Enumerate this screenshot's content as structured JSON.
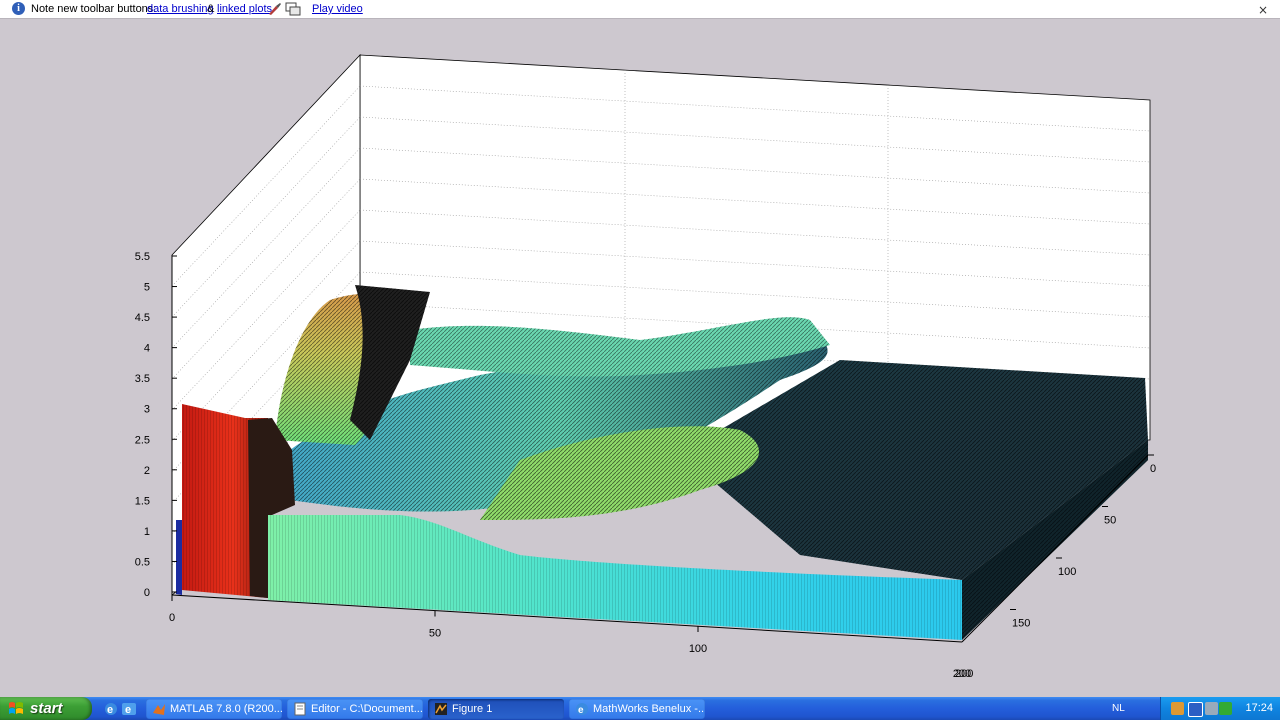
{
  "infobar": {
    "prefix": "Note new toolbar buttons:",
    "link_brushing": "data brushing",
    "amp": "&",
    "link_linked": "linked plots",
    "link_video": "Play video",
    "close": "×"
  },
  "plot": {
    "z_ticks": [
      "0",
      "0.5",
      "1",
      "1.5",
      "2",
      "2.5",
      "3",
      "3.5",
      "4",
      "4.5",
      "5",
      "5.5"
    ],
    "x_ticks": [
      "0",
      "50",
      "100"
    ],
    "x_end_tick": "200",
    "y_ticks": [
      "0",
      "50",
      "100",
      "150"
    ],
    "y_end_tick": "200"
  },
  "chart_data": {
    "type": "surface",
    "title": "",
    "xlabel": "",
    "ylabel": "",
    "zlabel": "",
    "xlim": [
      0,
      200
    ],
    "ylim": [
      0,
      200
    ],
    "zlim": [
      0,
      5.5
    ],
    "grid": true,
    "colormap": "jet",
    "description_values": {
      "front_edge_heights": [
        3.0,
        3.0,
        2.7,
        1.3,
        1.3,
        1.2,
        1.0,
        0.9,
        0.8,
        0.7
      ],
      "max_height": 5.0
    }
  },
  "taskbar": {
    "start_label": "start",
    "tasks": [
      {
        "label": "MATLAB 7.8.0 (R200...",
        "active": false
      },
      {
        "label": "Editor - C:\\Document...",
        "active": false
      },
      {
        "label": "Figure 1",
        "active": true
      },
      {
        "label": "MathWorks Benelux -...",
        "active": false
      }
    ],
    "lang": "NL",
    "clock": "17:24"
  },
  "colors": {
    "taskbar": "#245edb",
    "start": "#3c9f35",
    "background": "#cdc8cf"
  }
}
